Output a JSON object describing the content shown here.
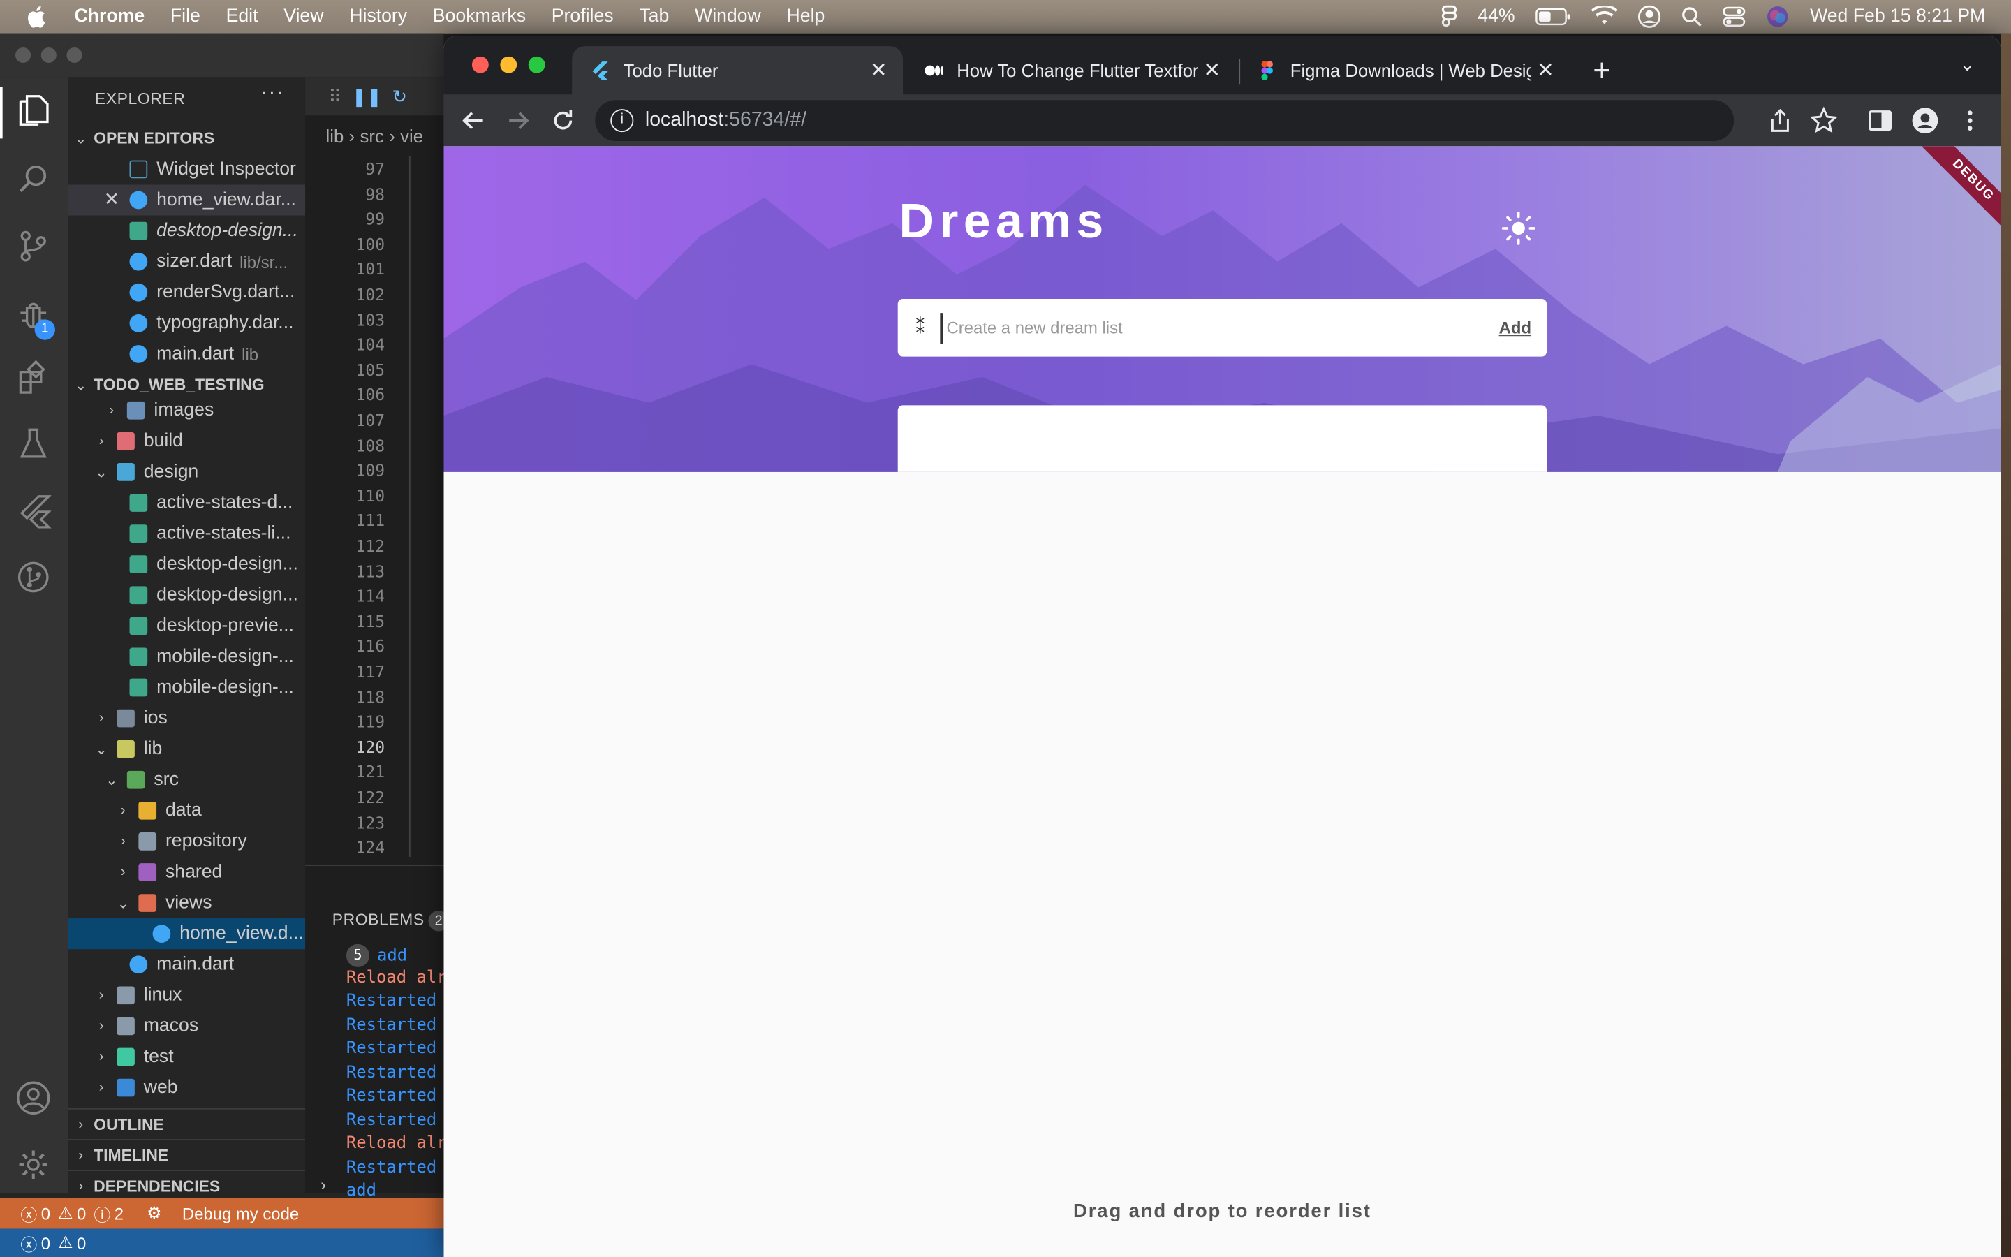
{
  "menubar": {
    "app": "Chrome",
    "items": [
      "File",
      "Edit",
      "View",
      "History",
      "Bookmarks",
      "Profiles",
      "Tab",
      "Window",
      "Help"
    ],
    "battery": "44%",
    "datetime": "Wed Feb 15  8:21 PM"
  },
  "vscode": {
    "explorer_title": "EXPLORER",
    "open_editors_title": "OPEN EDITORS",
    "open_editors": [
      {
        "label": "Widget Inspector",
        "hint": ""
      },
      {
        "label": "home_view.dar...",
        "hint": ""
      },
      {
        "label": "desktop-design...",
        "hint": ""
      },
      {
        "label": "sizer.dart",
        "hint": "lib/sr..."
      },
      {
        "label": "renderSvg.dart...",
        "hint": ""
      },
      {
        "label": "typography.dar...",
        "hint": ""
      },
      {
        "label": "main.dart",
        "hint": "lib"
      }
    ],
    "project_title": "TODO_WEB_TESTING",
    "tree": [
      "images",
      "build",
      "design",
      "active-states-d...",
      "active-states-li...",
      "desktop-design...",
      "desktop-design...",
      "desktop-previe...",
      "mobile-design-...",
      "mobile-design-...",
      "ios",
      "lib",
      "src",
      "data",
      "repository",
      "shared",
      "views",
      "home_view.d...",
      "main.dart",
      "linux",
      "macos",
      "test",
      "web"
    ],
    "outline": "OUTLINE",
    "timeline": "TIMELINE",
    "dependencies": "DEPENDENCIES",
    "breadcrumb": [
      "lib",
      "src",
      "vie"
    ],
    "line_numbers": [
      "97",
      "98",
      "99",
      "100",
      "101",
      "102",
      "103",
      "104",
      "105",
      "106",
      "107",
      "108",
      "109",
      "110",
      "111",
      "112",
      "113",
      "114",
      "115",
      "116",
      "117",
      "118",
      "119",
      "120",
      "121",
      "122",
      "123",
      "124"
    ],
    "current_line": "120",
    "panel_title": "PROBLEMS",
    "panel_badge": "2",
    "debug_badge": "1",
    "output": [
      {
        "text": "add",
        "badge": "5",
        "color": "#3794ff"
      },
      {
        "text": "Reload alr",
        "color": "#f48771"
      },
      {
        "text": "Restarted",
        "color": "#3794ff"
      },
      {
        "text": "Restarted",
        "color": "#3794ff"
      },
      {
        "text": "Restarted",
        "color": "#3794ff"
      },
      {
        "text": "Restarted",
        "color": "#3794ff"
      },
      {
        "text": "Restarted",
        "color": "#3794ff"
      },
      {
        "text": "Restarted",
        "color": "#3794ff"
      },
      {
        "text": "Reload alr",
        "color": "#f48771"
      },
      {
        "text": "Restarted",
        "color": "#3794ff"
      },
      {
        "text": "add",
        "color": "#3794ff"
      }
    ],
    "status": {
      "errors": "0",
      "warnings": "0",
      "info": "2",
      "debug_label": "Debug my code",
      "bottom_errors": "0",
      "bottom_warnings": "0"
    }
  },
  "chrome": {
    "tabs": [
      {
        "title": "Todo Flutter",
        "active": true
      },
      {
        "title": "How To Change Flutter Textform",
        "active": false
      },
      {
        "title": "Figma Downloads | Web Design",
        "active": false
      }
    ],
    "url_host": "localhost",
    "url_rest": ":56734/#/"
  },
  "app": {
    "title": "Dreams",
    "debug_banner": "DEBUG",
    "input_placeholder": "Create a new dream list",
    "add_label": "Add",
    "hint": "Drag and drop to reorder list"
  }
}
